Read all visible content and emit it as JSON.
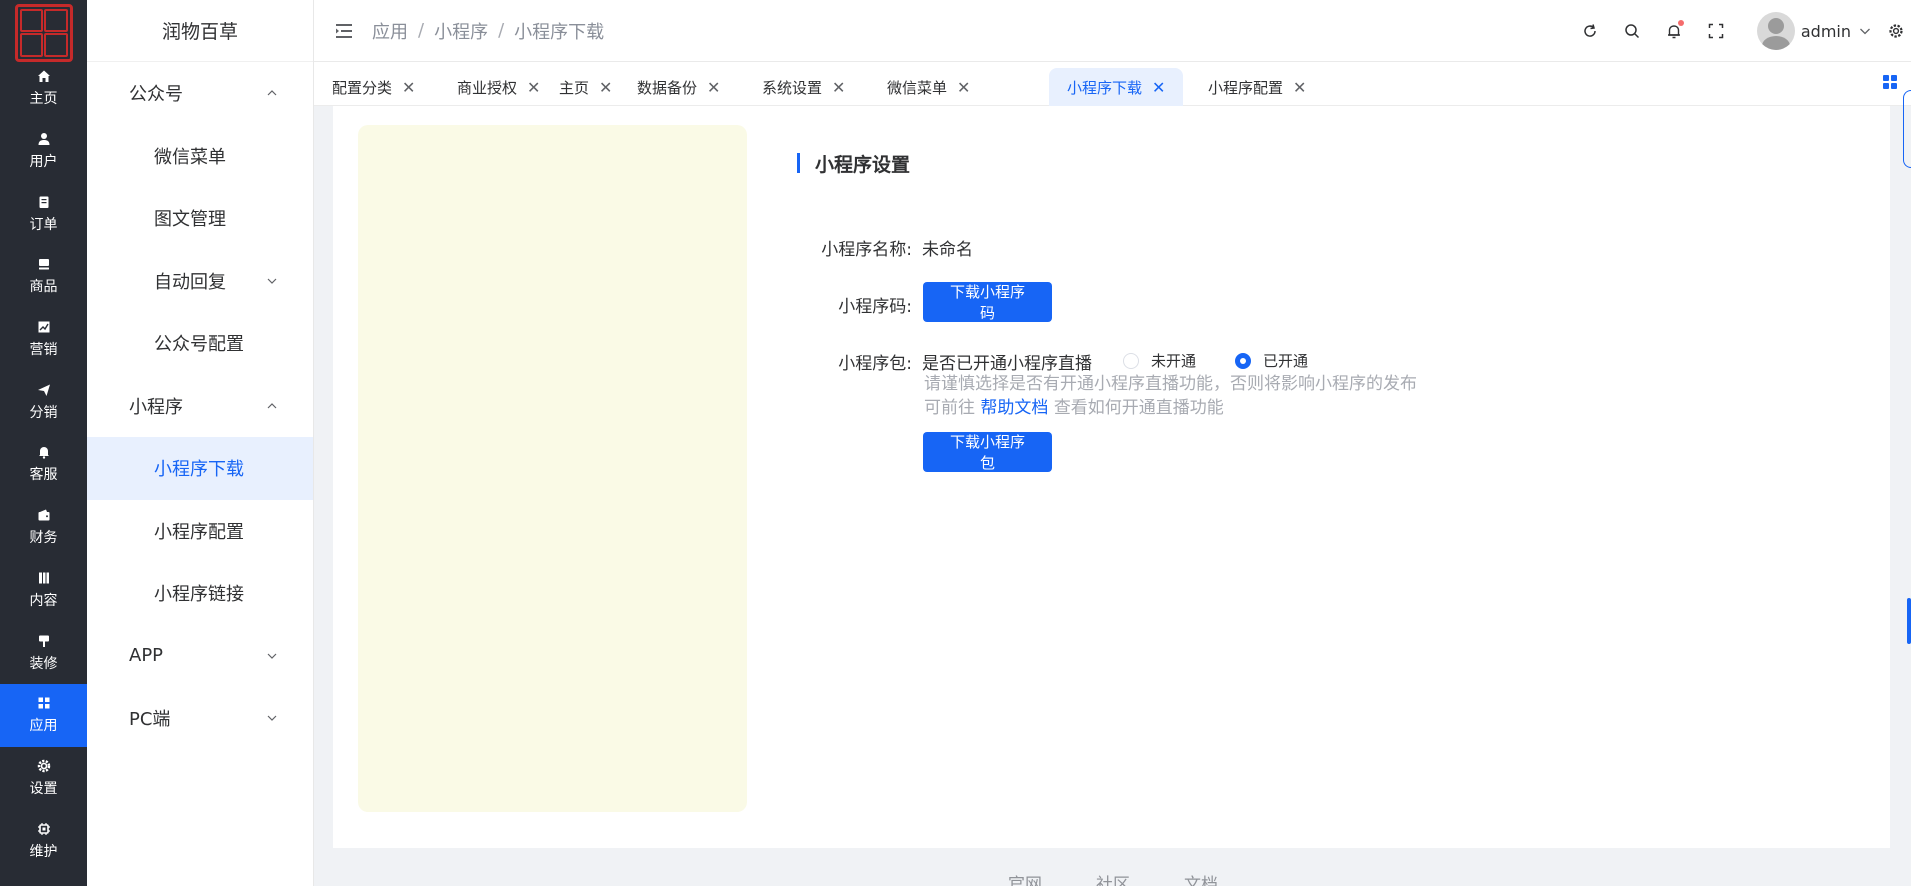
{
  "brand": {
    "name": "润物百草"
  },
  "rail": {
    "items": [
      {
        "label": "主页",
        "icon": "home-icon"
      },
      {
        "label": "用户",
        "icon": "user-icon"
      },
      {
        "label": "订单",
        "icon": "order-icon"
      },
      {
        "label": "商品",
        "icon": "goods-icon"
      },
      {
        "label": "营销",
        "icon": "marketing-icon"
      },
      {
        "label": "分销",
        "icon": "distribution-icon"
      },
      {
        "label": "客服",
        "icon": "service-icon"
      },
      {
        "label": "财务",
        "icon": "finance-icon"
      },
      {
        "label": "内容",
        "icon": "content-icon"
      },
      {
        "label": "装修",
        "icon": "decorate-icon"
      },
      {
        "label": "应用",
        "icon": "app-icon",
        "active": true
      },
      {
        "label": "设置",
        "icon": "settings-icon"
      },
      {
        "label": "维护",
        "icon": "maintain-icon"
      }
    ]
  },
  "sidebar": {
    "groups": [
      {
        "label": "公众号"
      },
      {
        "label": "小程序"
      },
      {
        "label": "APP"
      },
      {
        "label": "PC端"
      }
    ],
    "items": [
      {
        "label": "微信菜单"
      },
      {
        "label": "图文管理"
      },
      {
        "label": "自动回复"
      },
      {
        "label": "公众号配置"
      },
      {
        "label": "小程序下载"
      },
      {
        "label": "小程序配置"
      },
      {
        "label": "小程序链接"
      }
    ]
  },
  "breadcrumb": [
    "应用",
    "小程序",
    "小程序下载"
  ],
  "header": {
    "username": "admin"
  },
  "tabs": [
    {
      "label": "配置分类"
    },
    {
      "label": "商业授权"
    },
    {
      "label": "主页"
    },
    {
      "label": "数据备份"
    },
    {
      "label": "系统设置"
    },
    {
      "label": "微信菜单"
    },
    {
      "label": "小程序下载"
    },
    {
      "label": "小程序配置"
    }
  ],
  "content": {
    "section_title": "小程序设置",
    "name_label": "小程序名称:",
    "name_value": "未命名",
    "code_label": "小程序码:",
    "code_button": "下载小程序码",
    "package_label": "小程序包:",
    "live_question": "是否已开通小程序直播",
    "radio_off": "未开通",
    "radio_on": "已开通",
    "radio_selected": "已开通",
    "hint_prefix": "请谨慎选择是否有开通小程序直播功能，否则将影响小程序的发布 可前往",
    "hint_link": "帮助文档",
    "hint_suffix": "查看如何开通直播功能",
    "package_button": "下载小程序包"
  },
  "footer": {
    "links": [
      "官网",
      "社区",
      "文档"
    ]
  },
  "colors": {
    "accent": "#1765f5",
    "rail_bg": "#282c34",
    "preview_bg": "#fafae6"
  }
}
